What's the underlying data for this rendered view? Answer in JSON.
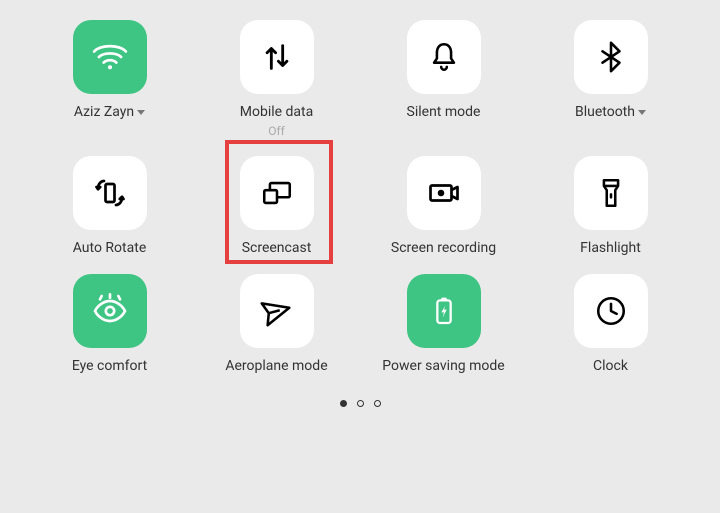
{
  "tiles": [
    {
      "label": "Aziz Zayn",
      "hasDropdown": true,
      "active": true
    },
    {
      "label": "Mobile data",
      "sublabel": "Off",
      "active": false
    },
    {
      "label": "Silent mode",
      "active": false
    },
    {
      "label": "Bluetooth",
      "hasDropdown": true,
      "active": false
    },
    {
      "label": "Auto Rotate",
      "active": false
    },
    {
      "label": "Screencast",
      "active": false,
      "highlighted": true
    },
    {
      "label": "Screen recording",
      "active": false
    },
    {
      "label": "Flashlight",
      "active": false
    },
    {
      "label": "Eye comfort",
      "active": true
    },
    {
      "label": "Aeroplane mode",
      "active": false
    },
    {
      "label": "Power saving mode",
      "active": true
    },
    {
      "label": "Clock",
      "active": false
    }
  ],
  "pagination": {
    "current": 0,
    "total": 3
  }
}
